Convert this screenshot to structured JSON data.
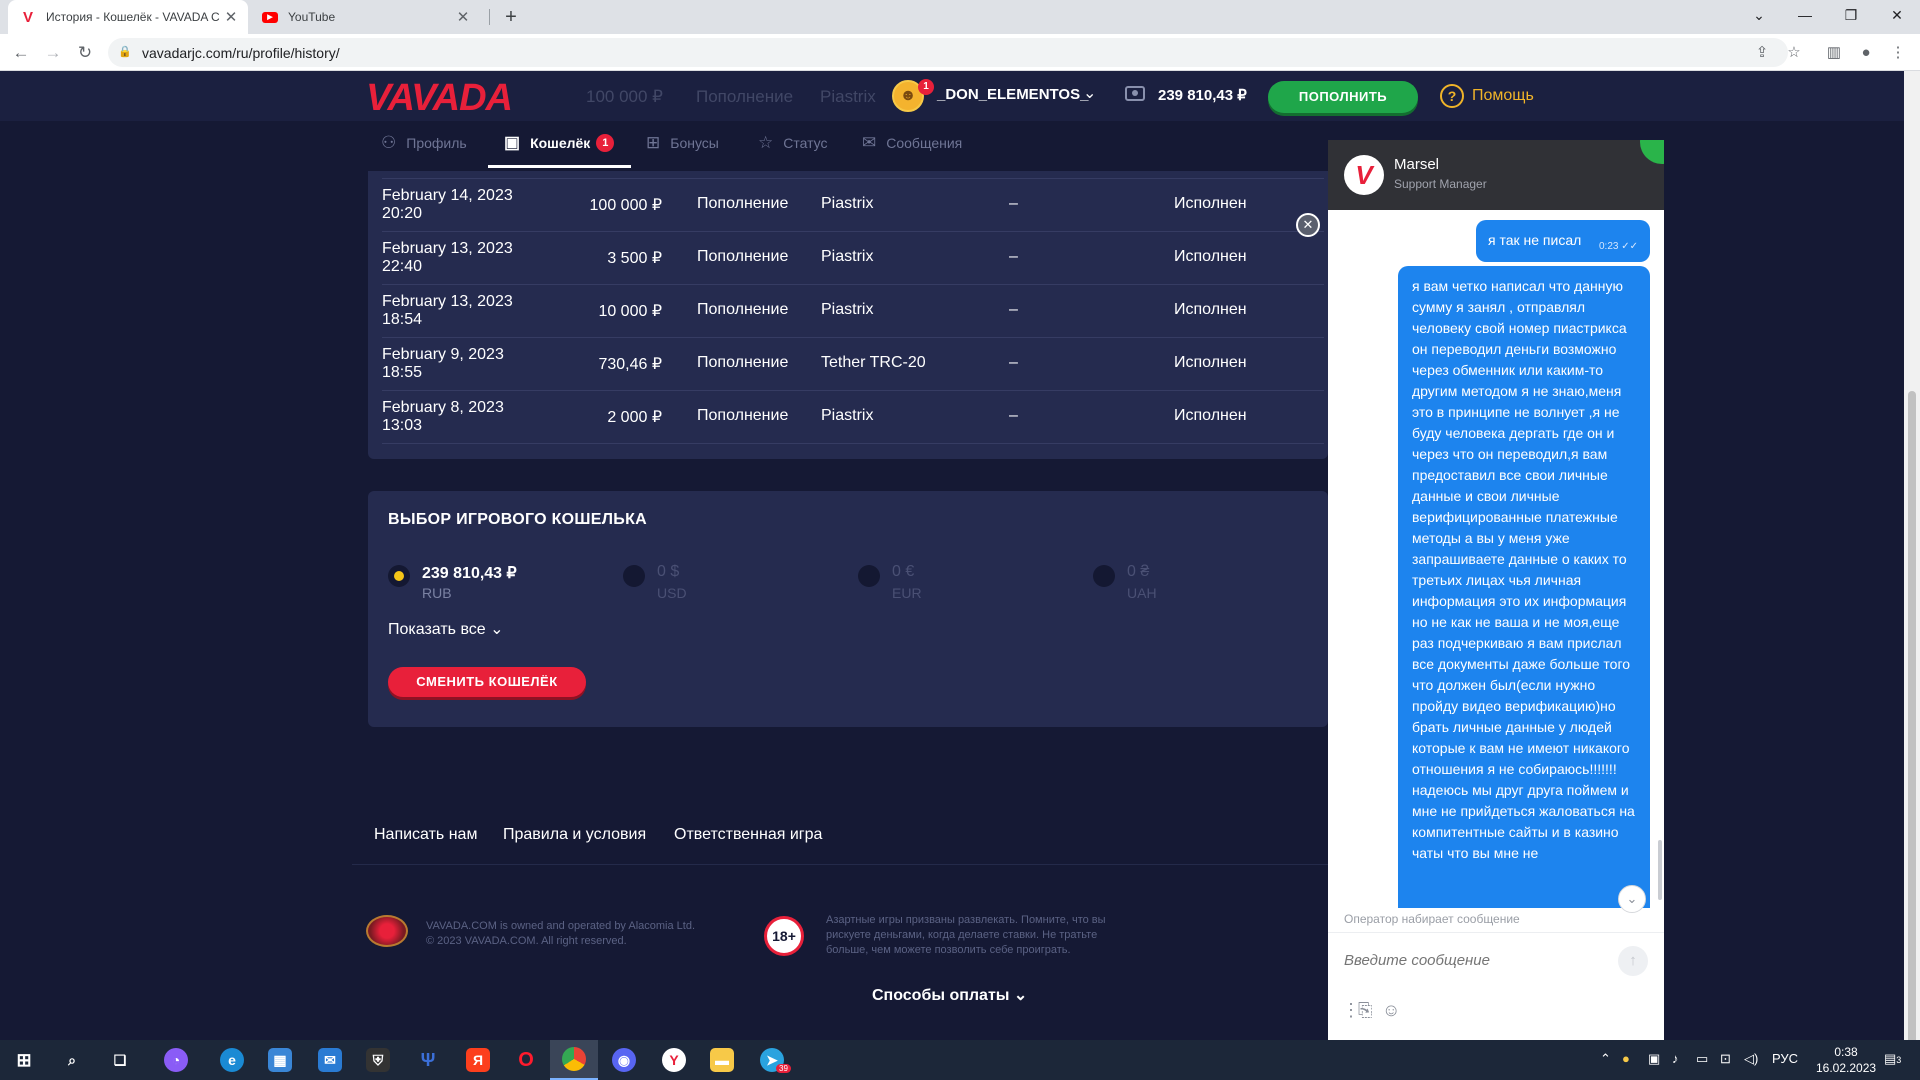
{
  "browser": {
    "tabs": [
      {
        "title": "История - Кошелёк - VAVADA C",
        "active": true
      },
      {
        "title": "YouTube",
        "active": false
      }
    ],
    "url": "vavadarjc.com/ru/profile/history/"
  },
  "header": {
    "logo": "VAVADA",
    "username": "_DON_ELEMENTOS_",
    "notification_count": "1",
    "balance": "239 810,43 ₽",
    "deposit_label": "ПОПОЛНИТЬ",
    "help_label": "Помощь",
    "ghost_amount": "100 000 ₽",
    "ghost_type": "Пополнение",
    "ghost_method": "Piastrix"
  },
  "subnav": {
    "items": [
      {
        "label": "Профиль",
        "icon": "user-icon"
      },
      {
        "label": "Кошелёк",
        "icon": "wallet-icon",
        "badge": "1"
      },
      {
        "label": "Бонусы",
        "icon": "gift-icon"
      },
      {
        "label": "Статус",
        "icon": "star-icon"
      },
      {
        "label": "Сообщения",
        "icon": "mail-icon"
      }
    ]
  },
  "history": {
    "rows": [
      {
        "date": "February 14, 2023",
        "time": "20:20",
        "amount": "100 000 ₽",
        "type": "Пополнение",
        "method": "Piastrix",
        "dash": "–",
        "status": "Исполнен"
      },
      {
        "date": "February 13, 2023",
        "time": "22:40",
        "amount": "3 500 ₽",
        "type": "Пополнение",
        "method": "Piastrix",
        "dash": "–",
        "status": "Исполнен"
      },
      {
        "date": "February 13, 2023",
        "time": "18:54",
        "amount": "10 000 ₽",
        "type": "Пополнение",
        "method": "Piastrix",
        "dash": "–",
        "status": "Исполнен"
      },
      {
        "date": "February 9, 2023",
        "time": "18:55",
        "amount": "730,46 ₽",
        "type": "Пополнение",
        "method": "Tether TRC-20",
        "dash": "–",
        "status": "Исполнен"
      },
      {
        "date": "February 8, 2023",
        "time": "13:03",
        "amount": "2 000 ₽",
        "type": "Пополнение",
        "method": "Piastrix",
        "dash": "–",
        "status": "Исполнен"
      }
    ]
  },
  "wallet": {
    "title": "ВЫБОР ИГРОВОГО КОШЕЛЬКА",
    "currencies": [
      {
        "amount": "239 810,43 ₽",
        "code": "RUB",
        "selected": true
      },
      {
        "amount": "0 $",
        "code": "USD",
        "selected": false
      },
      {
        "amount": "0 €",
        "code": "EUR",
        "selected": false
      },
      {
        "amount": "0 ₴",
        "code": "UAH",
        "selected": false
      }
    ],
    "show_all": "Показать все",
    "change_button": "СМЕНИТЬ КОШЕЛЁК"
  },
  "footer": {
    "links": [
      "Написать нам",
      "Правила и условия",
      "Ответственная игра"
    ],
    "owner_line1": "VAVADA.COM is owned and operated by Alacomia Ltd.",
    "owner_line2": "© 2023 VAVADA.COM. All right reserved.",
    "age": "18+",
    "disclaimer_line1": "Азартные игры призваны развлекать. Помните, что вы",
    "disclaimer_line2": "рискуете деньгами, когда делаете ставки. Не тратьте",
    "disclaimer_line3": "больше, чем можете позволить себе проиграть.",
    "payments": "Способы оплаты"
  },
  "chat": {
    "agent_name": "Marsel",
    "agent_role": "Support Manager",
    "messages": [
      {
        "text": "я так не писал",
        "time": "0:23"
      },
      {
        "text": "я вам четко написал что данную сумму я занял , отправлял человеку свой номер пиастрикса он переводил деньги возможно через обменник или каким-то другим методом я не знаю,меня это в принципе не волнует ,я не буду человека дергать где он и через что он переводил,я вам предоставил все свои личные данные и свои личные верифицированные платежные методы а вы у меня уже запрашиваете данные о каких то третьих лицах чья личная информация это их информация но не как не ваша и не моя,еще раз подчеркиваю я вам прислал все документы даже больше того что должен был(если нужно пройду видео верификацию)но брать личные данные у людей которые к вам не имеют никакого отношения я не собираюсь!!!!!!!надеюсь мы друг друга поймем и мне не прийдеться жаловаться на компитентные сайты и в казино чаты что вы мне не"
      }
    ],
    "typing": "Оператор набирает сообщение",
    "input_placeholder": "Введите сообщение"
  },
  "taskbar": {
    "lang": "РУС",
    "time": "0:38",
    "date": "16.02.2023",
    "telegram_badge": "39",
    "notifications": "3"
  },
  "colors": {
    "brand_red": "#e8203a",
    "deposit_green": "#1fa64a",
    "help_yellow": "#f0b429",
    "chat_bubble": "#1d84ee",
    "page_bg": "#151934",
    "panel_bg": "#252b4f"
  }
}
